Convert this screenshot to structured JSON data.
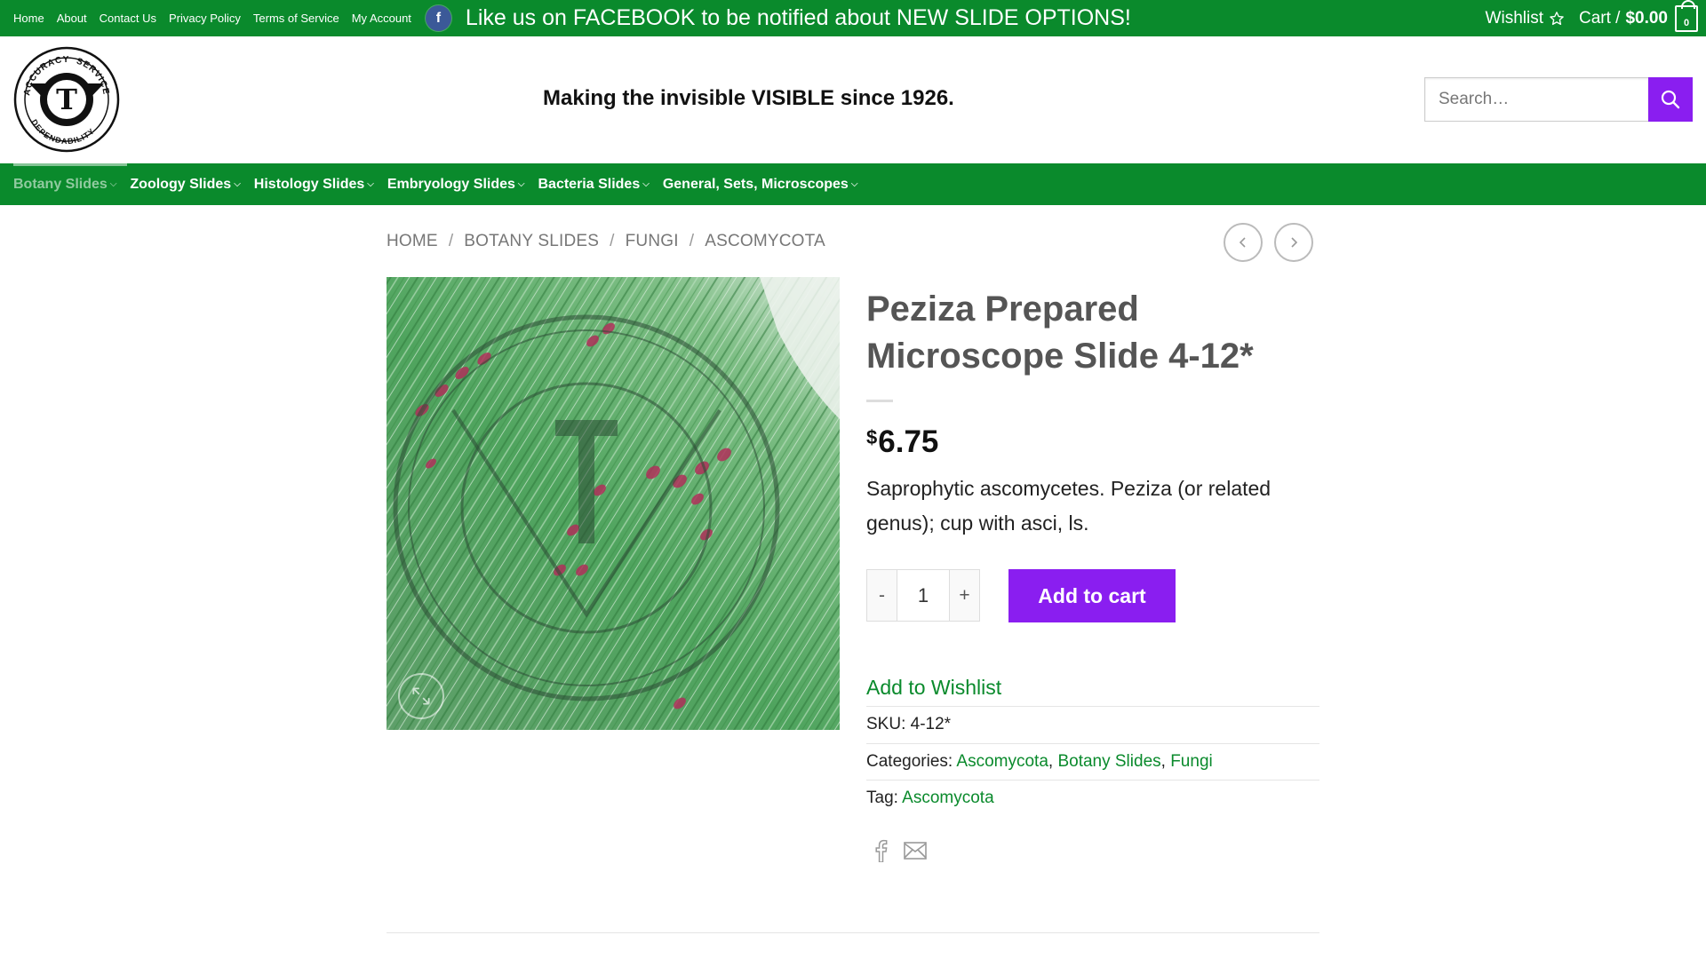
{
  "topbar": {
    "links": [
      "Home",
      "About",
      "Contact Us",
      "Privacy Policy",
      "Terms of Service",
      "My Account"
    ],
    "facebook_icon": "facebook-icon",
    "promo": "Like us on FACEBOOK to be notified about NEW SLIDE OPTIONS!",
    "wishlist_label": "Wishlist",
    "cart_label": "Cart /",
    "cart_total": "$0.00",
    "cart_count": "0"
  },
  "header": {
    "logo_text": [
      "ACCURACY",
      "SERVICE",
      "DEPENDABILITY",
      "T"
    ],
    "tagline": "Making the invisible VISIBLE since 1926.",
    "search_placeholder": "Search…"
  },
  "nav": {
    "items": [
      "Botany Slides",
      "Zoology Slides",
      "Histology Slides",
      "Embryology Slides",
      "Bacteria Slides",
      "General, Sets, Microscopes"
    ],
    "active_index": 0
  },
  "breadcrumb": [
    "HOME",
    "BOTANY SLIDES",
    "FUNGI",
    "ASCOMYCOTA"
  ],
  "product": {
    "title": "Peziza Prepared Microscope Slide 4-12*",
    "currency": "$",
    "price": "6.75",
    "description": "Saprophytic ascomycetes. Peziza (or related genus); cup with asci, ls.",
    "quantity": "1",
    "qty_minus": "-",
    "qty_plus": "+",
    "add_to_cart": "Add to cart",
    "add_to_wishlist": "Add to Wishlist",
    "sku_label": "SKU:",
    "sku": "4-12*",
    "categories_label": "Categories:",
    "categories": [
      "Ascomycota",
      "Botany Slides",
      "Fungi"
    ],
    "tag_label": "Tag:",
    "tag": "Ascomycota"
  },
  "colors": {
    "brand_green": "#0a8a2c",
    "accent_purple": "#8a1ef0"
  }
}
